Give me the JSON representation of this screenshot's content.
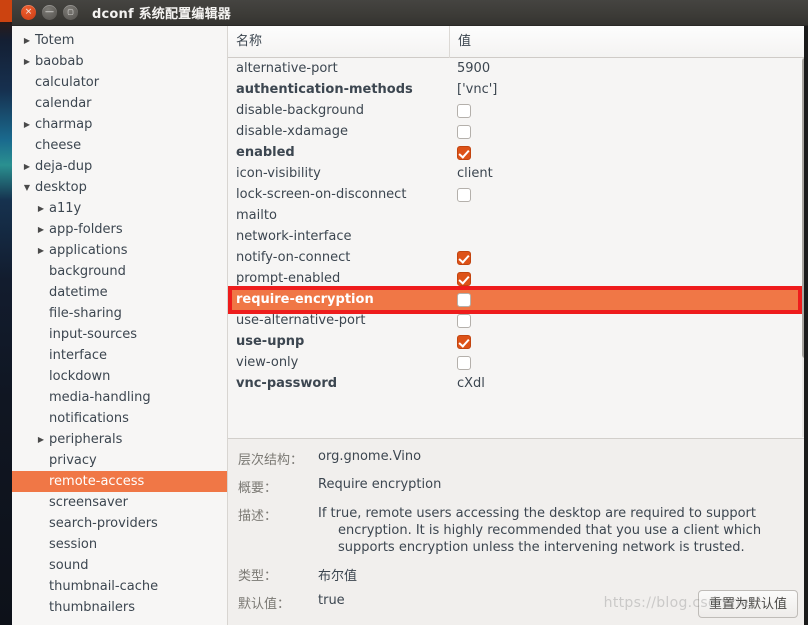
{
  "window": {
    "title": "dconf 系统配置编辑器",
    "controls": [
      {
        "name": "close",
        "glyph": "×"
      },
      {
        "name": "minimize",
        "glyph": "—"
      },
      {
        "name": "maximize",
        "glyph": "▢"
      }
    ]
  },
  "sidebar": {
    "items": [
      {
        "label": "Totem",
        "indent": 1,
        "arrow": "right",
        "selected": false
      },
      {
        "label": "baobab",
        "indent": 1,
        "arrow": "right",
        "selected": false
      },
      {
        "label": "calculator",
        "indent": 1,
        "arrow": "none",
        "selected": false
      },
      {
        "label": "calendar",
        "indent": 1,
        "arrow": "none",
        "selected": false
      },
      {
        "label": "charmap",
        "indent": 1,
        "arrow": "right",
        "selected": false
      },
      {
        "label": "cheese",
        "indent": 1,
        "arrow": "none",
        "selected": false
      },
      {
        "label": "deja-dup",
        "indent": 1,
        "arrow": "right",
        "selected": false
      },
      {
        "label": "desktop",
        "indent": 1,
        "arrow": "down",
        "selected": false
      },
      {
        "label": "a11y",
        "indent": 2,
        "arrow": "right",
        "selected": false
      },
      {
        "label": "app-folders",
        "indent": 2,
        "arrow": "right",
        "selected": false
      },
      {
        "label": "applications",
        "indent": 2,
        "arrow": "right",
        "selected": false
      },
      {
        "label": "background",
        "indent": 2,
        "arrow": "none",
        "selected": false
      },
      {
        "label": "datetime",
        "indent": 2,
        "arrow": "none",
        "selected": false
      },
      {
        "label": "file-sharing",
        "indent": 2,
        "arrow": "none",
        "selected": false
      },
      {
        "label": "input-sources",
        "indent": 2,
        "arrow": "none",
        "selected": false
      },
      {
        "label": "interface",
        "indent": 2,
        "arrow": "none",
        "selected": false
      },
      {
        "label": "lockdown",
        "indent": 2,
        "arrow": "none",
        "selected": false
      },
      {
        "label": "media-handling",
        "indent": 2,
        "arrow": "none",
        "selected": false
      },
      {
        "label": "notifications",
        "indent": 2,
        "arrow": "none",
        "selected": false
      },
      {
        "label": "peripherals",
        "indent": 2,
        "arrow": "right",
        "selected": false
      },
      {
        "label": "privacy",
        "indent": 2,
        "arrow": "none",
        "selected": false
      },
      {
        "label": "remote-access",
        "indent": 2,
        "arrow": "none",
        "selected": true
      },
      {
        "label": "screensaver",
        "indent": 2,
        "arrow": "none",
        "selected": false
      },
      {
        "label": "search-providers",
        "indent": 2,
        "arrow": "none",
        "selected": false
      },
      {
        "label": "session",
        "indent": 2,
        "arrow": "none",
        "selected": false
      },
      {
        "label": "sound",
        "indent": 2,
        "arrow": "none",
        "selected": false
      },
      {
        "label": "thumbnail-cache",
        "indent": 2,
        "arrow": "none",
        "selected": false
      },
      {
        "label": "thumbnailers",
        "indent": 2,
        "arrow": "none",
        "selected": false
      }
    ]
  },
  "list": {
    "columns": {
      "name": "名称",
      "value": "值"
    },
    "rows": [
      {
        "key": "alternative-port",
        "value": "5900",
        "type": "text",
        "bold": false,
        "selected": false
      },
      {
        "key": "authentication-methods",
        "value": "['vnc']",
        "type": "text",
        "bold": true,
        "selected": false
      },
      {
        "key": "disable-background",
        "value": "",
        "type": "checkbox",
        "checked": false,
        "bold": false,
        "selected": false
      },
      {
        "key": "disable-xdamage",
        "value": "",
        "type": "checkbox",
        "checked": false,
        "bold": false,
        "selected": false
      },
      {
        "key": "enabled",
        "value": "",
        "type": "checkbox",
        "checked": true,
        "bold": true,
        "selected": false
      },
      {
        "key": "icon-visibility",
        "value": "client",
        "type": "text",
        "bold": false,
        "selected": false
      },
      {
        "key": "lock-screen-on-disconnect",
        "value": "",
        "type": "checkbox",
        "checked": false,
        "bold": false,
        "selected": false
      },
      {
        "key": "mailto",
        "value": "",
        "type": "text",
        "bold": false,
        "selected": false
      },
      {
        "key": "network-interface",
        "value": "",
        "type": "text",
        "bold": false,
        "selected": false
      },
      {
        "key": "notify-on-connect",
        "value": "",
        "type": "checkbox",
        "checked": true,
        "bold": false,
        "selected": false
      },
      {
        "key": "prompt-enabled",
        "value": "",
        "type": "checkbox",
        "checked": true,
        "bold": false,
        "selected": false
      },
      {
        "key": "require-encryption",
        "value": "",
        "type": "checkbox",
        "checked": false,
        "bold": true,
        "selected": true
      },
      {
        "key": "use-alternative-port",
        "value": "",
        "type": "checkbox",
        "checked": false,
        "bold": false,
        "selected": false
      },
      {
        "key": "use-upnp",
        "value": "",
        "type": "checkbox",
        "checked": true,
        "bold": true,
        "selected": false
      },
      {
        "key": "view-only",
        "value": "",
        "type": "checkbox",
        "checked": false,
        "bold": false,
        "selected": false
      },
      {
        "key": "vnc-password",
        "value": "cXdl",
        "type": "text",
        "bold": true,
        "selected": false
      }
    ]
  },
  "detail": {
    "schema_label": "层次结构：",
    "schema_value": "org.gnome.Vino",
    "summary_label": "概要：",
    "summary_value": "Require encryption",
    "description_label": "描述：",
    "description_value": "If true, remote users accessing the desktop are required to support encryption. It is highly recommended that you use a client which supports encryption unless the intervening network is trusted.",
    "type_label": "类型：",
    "type_value": "布尔值",
    "default_label": "默认值：",
    "default_value": "true",
    "reset_button": "重置为默认值"
  },
  "watermark": "https://blog.csdn.net/",
  "colors": {
    "accent_orange": "#f07746",
    "checkbox_checked": "#dd5218",
    "highlight_red": "#ee1c1c",
    "titlebar": "#3c3b37"
  }
}
